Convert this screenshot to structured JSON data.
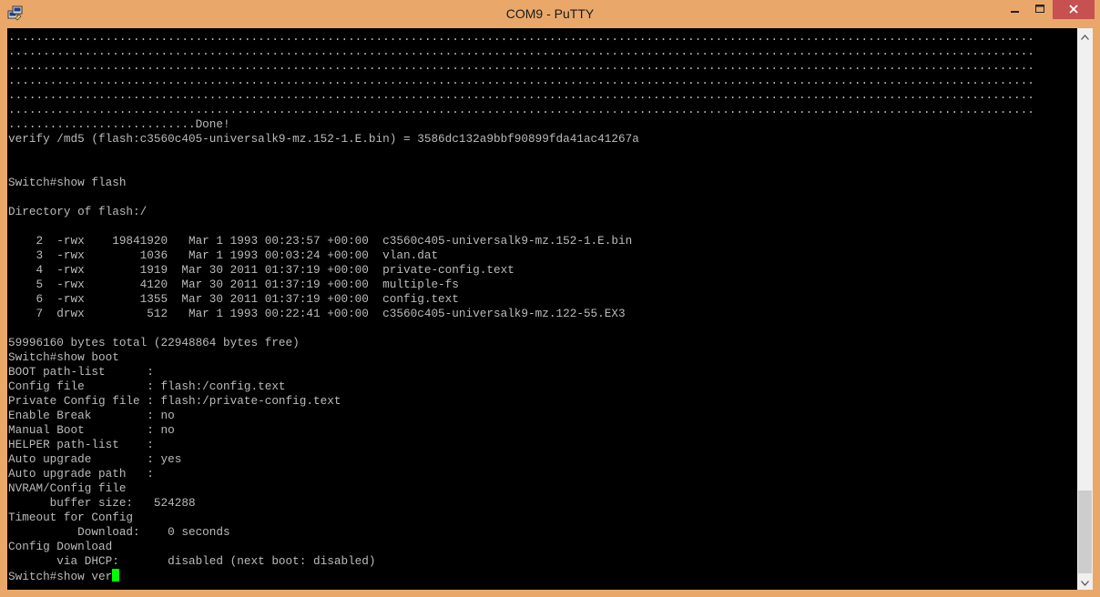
{
  "window": {
    "title": "COM9 - PuTTY",
    "frame_color": "#e9a86a",
    "close_color": "#c75050"
  },
  "icons": {
    "app": "putty-app-icon",
    "minimize": "minimize-icon",
    "maximize": "maximize-icon",
    "close": "close-icon",
    "scroll_up": "scroll-up-arrow-icon",
    "scroll_down": "scroll-down-arrow-icon"
  },
  "terminal": {
    "background": "#000000",
    "foreground": "#bbbbbb",
    "cursor_color": "#00ff00",
    "lines": [
      "....................................................................................................................................................",
      "....................................................................................................................................................",
      "....................................................................................................................................................",
      "....................................................................................................................................................",
      "....................................................................................................................................................",
      "....................................................................................................................................................",
      "...........................Done!",
      "verify /md5 (flash:c3560c405-universalk9-mz.152-1.E.bin) = 3586dc132a9bbf90899fda41ac41267a",
      "",
      "",
      "Switch#show flash",
      "",
      "Directory of flash:/",
      "",
      "    2  -rwx    19841920   Mar 1 1993 00:23:57 +00:00  c3560c405-universalk9-mz.152-1.E.bin",
      "    3  -rwx        1036   Mar 1 1993 00:03:24 +00:00  vlan.dat",
      "    4  -rwx        1919  Mar 30 2011 01:37:19 +00:00  private-config.text",
      "    5  -rwx        4120  Mar 30 2011 01:37:19 +00:00  multiple-fs",
      "    6  -rwx        1355  Mar 30 2011 01:37:19 +00:00  config.text",
      "    7  drwx         512   Mar 1 1993 00:22:41 +00:00  c3560c405-universalk9-mz.122-55.EX3",
      "",
      "59996160 bytes total (22948864 bytes free)",
      "Switch#show boot",
      "BOOT path-list      :",
      "Config file         : flash:/config.text",
      "Private Config file : flash:/private-config.text",
      "Enable Break        : no",
      "Manual Boot         : no",
      "HELPER path-list    :",
      "Auto upgrade        : yes",
      "Auto upgrade path   :",
      "NVRAM/Config file",
      "      buffer size:   524288",
      "Timeout for Config",
      "          Download:    0 seconds",
      "Config Download",
      "       via DHCP:       disabled (next boot: disabled)"
    ],
    "prompt_line": "Switch#show ver"
  }
}
